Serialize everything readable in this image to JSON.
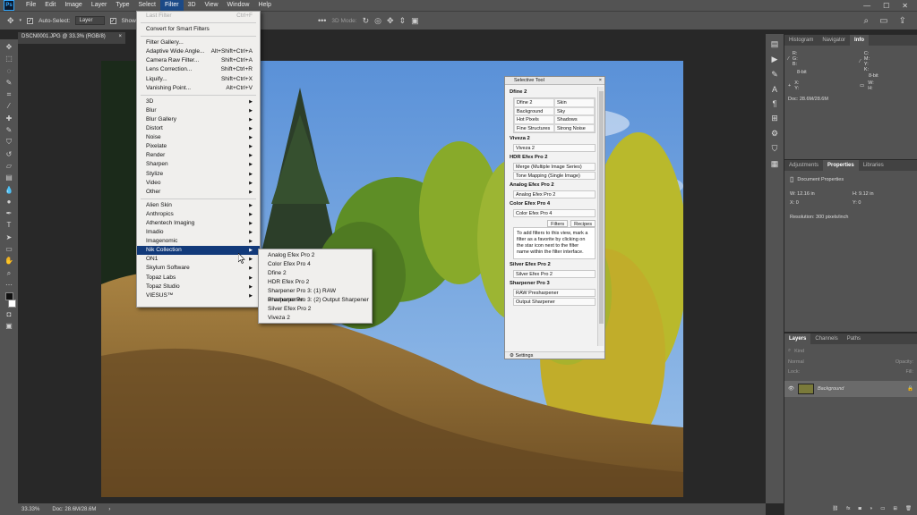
{
  "menubar": {
    "logo": "Ps",
    "items": [
      "File",
      "Edit",
      "Image",
      "Layer",
      "Type",
      "Select",
      "Filter",
      "3D",
      "View",
      "Window",
      "Help"
    ],
    "active": "Filter",
    "window_controls": [
      "—",
      "☐",
      "✕"
    ]
  },
  "optionsbar": {
    "auto_select_label": "Auto-Select:",
    "layer_select": "Layer",
    "show_transform_label": "Show Tra",
    "mode_3d_label": "3D Mode:"
  },
  "document": {
    "tab_title": "DSCN0001.JPG @ 33.3% (RGB/8)",
    "tab_close": "×"
  },
  "statusbar": {
    "zoom": "33.33%",
    "doc_size": "Doc: 28.6M/28.6M"
  },
  "filter_menu": {
    "items": [
      {
        "label": "Last Filter",
        "shortcut": "Ctrl+F",
        "disabled": true
      },
      {
        "sep": true
      },
      {
        "label": "Convert for Smart Filters"
      },
      {
        "sep": true
      },
      {
        "label": "Filter Gallery..."
      },
      {
        "label": "Adaptive Wide Angle...",
        "shortcut": "Alt+Shift+Ctrl+A"
      },
      {
        "label": "Camera Raw Filter...",
        "shortcut": "Shift+Ctrl+A"
      },
      {
        "label": "Lens Correction...",
        "shortcut": "Shift+Ctrl+R"
      },
      {
        "label": "Liquify...",
        "shortcut": "Shift+Ctrl+X"
      },
      {
        "label": "Vanishing Point...",
        "shortcut": "Alt+Ctrl+V"
      },
      {
        "sep": true
      },
      {
        "label": "3D",
        "sub": true
      },
      {
        "label": "Blur",
        "sub": true
      },
      {
        "label": "Blur Gallery",
        "sub": true
      },
      {
        "label": "Distort",
        "sub": true
      },
      {
        "label": "Noise",
        "sub": true
      },
      {
        "label": "Pixelate",
        "sub": true
      },
      {
        "label": "Render",
        "sub": true
      },
      {
        "label": "Sharpen",
        "sub": true
      },
      {
        "label": "Stylize",
        "sub": true
      },
      {
        "label": "Video",
        "sub": true
      },
      {
        "label": "Other",
        "sub": true
      },
      {
        "sep": true
      },
      {
        "label": "Alien Skin",
        "sub": true
      },
      {
        "label": "Anthropics",
        "sub": true
      },
      {
        "label": "Athentech Imaging",
        "sub": true
      },
      {
        "label": "Imadio",
        "sub": true
      },
      {
        "label": "Imagenomic",
        "sub": true
      },
      {
        "label": "Nik Collection",
        "sub": true,
        "highlighted": true
      },
      {
        "label": "ON1",
        "sub": true
      },
      {
        "label": "Skylum Software",
        "sub": true
      },
      {
        "label": "Topaz Labs",
        "sub": true
      },
      {
        "label": "Topaz Studio",
        "sub": true
      },
      {
        "label": "VIESUS™",
        "sub": true
      }
    ]
  },
  "nik_submenu": {
    "items": [
      "Analog Efex Pro 2",
      "Color Efex Pro 4",
      "Dfine 2",
      "HDR Efex Pro 2",
      "Sharpener Pro 3: (1) RAW Presharpener",
      "Sharpener Pro 3: (2) Output Sharpener",
      "Silver Efex Pro 2",
      "Viveza 2"
    ]
  },
  "selective_tool": {
    "title": "Selective Tool",
    "close": "×",
    "dfine": {
      "heading": "Dfine 2",
      "cells": [
        "Dfine 2",
        "Skin",
        "Background",
        "Sky",
        "Hot Pixels",
        "Shadows",
        "Fine Structures",
        "Strong Noise"
      ]
    },
    "viveza": {
      "heading": "Viveza 2",
      "buttons": [
        "Viveza 2"
      ]
    },
    "hdr": {
      "heading": "HDR Efex Pro 2",
      "buttons": [
        "Merge (Multiple Image Series)",
        "Tone Mapping (Single Image)"
      ]
    },
    "analog": {
      "heading": "Analog Efex Pro 2",
      "buttons": [
        "Analog Efex Pro 2"
      ]
    },
    "color": {
      "heading": "Color Efex Pro 4",
      "buttons": [
        "Color Efex Pro 4"
      ]
    },
    "tabs": [
      "Filters",
      "Recipes"
    ],
    "info_text": "To add filters to this view, mark a filter as a favorite by clicking on the star icon next to the filter name within the filter interface.",
    "silver": {
      "heading": "Silver Efex Pro 2",
      "buttons": [
        "Silver Efex Pro 2"
      ]
    },
    "sharpener": {
      "heading": "Sharpener Pro 3",
      "buttons": [
        "RAW Presharpener",
        "Output Sharpener"
      ]
    },
    "footer": "Settings"
  },
  "panels": {
    "info_tabs": [
      "Histogram",
      "Navigator",
      "Info"
    ],
    "info_active": "Info",
    "info_rgb": [
      "R:",
      "G:",
      "B:"
    ],
    "info_cmyk": [
      "C:",
      "M:",
      "Y:",
      "K:"
    ],
    "info_bit_left": "8-bit",
    "info_bit_right": "8-bit",
    "info_xy": [
      "X:",
      "Y:"
    ],
    "info_wh": [
      "W:",
      "H:"
    ],
    "info_doc": "Doc: 28.6M/28.6M",
    "props_tabs": [
      "Adjustments",
      "Properties",
      "Libraries"
    ],
    "props_active": "Properties",
    "props_title": "Document Properties",
    "props_w": "W:  12.16 in",
    "props_h": "H:  9.12 in",
    "props_x": "X:  0",
    "props_y": "Y:  0",
    "props_res": "Resolution: 300 pixels/inch",
    "layers_tabs": [
      "Layers",
      "Channels",
      "Paths"
    ],
    "layers_active": "Layers",
    "layers_kind": "Kind",
    "layers_mode": "Normal",
    "layers_opacity": "Opacity:",
    "layers_lock": "Lock:",
    "layers_fill": "Fill:",
    "layer_name": "Background"
  },
  "colors": {
    "ui_dark": "#282828",
    "panel": "#535353",
    "menu_highlight": "#123a7a"
  }
}
